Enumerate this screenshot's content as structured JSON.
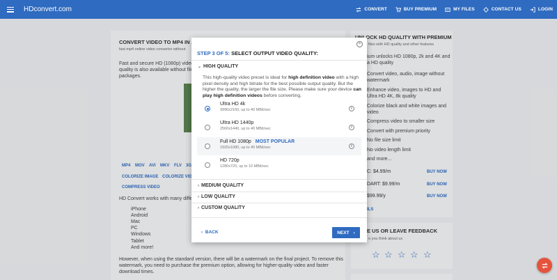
{
  "header": {
    "logo": "HDconvert.com",
    "nav": [
      {
        "label": "CONVERT",
        "icon": "convert-icon"
      },
      {
        "label": "BUY PREMIUM",
        "icon": "cart-icon"
      },
      {
        "label": "MY FILES",
        "icon": "files-icon"
      },
      {
        "label": "CONTACT US",
        "icon": "contact-icon"
      },
      {
        "label": "LOGIN",
        "icon": "login-icon"
      }
    ]
  },
  "main": {
    "title": "CONVERT VIDEO TO MP4 IN A F",
    "subtitle": "fast mp4 online video convertor without",
    "intro_line1": "Fast and secure HD (1080p) video",
    "intro_line2": "quality is also available without file",
    "intro_line3": "packages.",
    "formats": [
      "MP4",
      "MOV",
      "AVI",
      "MKV",
      "FLV",
      "3G"
    ],
    "tools_line1": [
      "COLORIZE IMAGE",
      "COLORIZE VID"
    ],
    "tools_line2": "COMPRESS VIDEO",
    "devices_intro": "HD Convert works with many differ",
    "devices": [
      "iPhone",
      "Android",
      "Mac",
      "PC",
      "Windows",
      "Tablet",
      "And more!"
    ],
    "watermark_line1": "However, when using the standard version, there will be a watermark on the final project. To remove this",
    "watermark_line2": "watermark, you need to purchase the premium option, allowing for higher-quality video and faster",
    "watermark_line3": "download times."
  },
  "side": {
    "title": "UNLOCK HD QUALITY WITH PREMIUM",
    "subtitle": "files with HD quality and other features",
    "features": [
      "ium unlocks HD 1080p, 2k and 4K and",
      "a HD quality",
      "Convert video, audio, image without",
      "watermark",
      "Enhance video, images to HD and",
      "Ultra HD 4K, 8k quality",
      "Colorize black and white images and",
      "video",
      "Compress video to smaller size",
      "Convert with premium priority",
      "No file size limit",
      "No video length limit",
      "and more..."
    ],
    "plans": [
      {
        "price": "C: $4.99/m",
        "action": "BUY NOW"
      },
      {
        "price": "DART: $9.99/m",
        "action": "BUY NOW"
      },
      {
        "price": "$99.99/y",
        "action": "BUY NOW"
      }
    ],
    "details_link": "ILS",
    "feedback_title": "E US OR LEAVE FEEDBACK",
    "feedback_sub": "o you think about us",
    "stars": [
      "☆",
      "☆",
      "☆",
      "☆",
      "☆"
    ]
  },
  "modal": {
    "close": "×",
    "step_prefix": "STEP 3 OF 5:",
    "step_title": "SELECT OUTPUT VIDEO QUALITY:",
    "high_section": "HIGH QUALITY",
    "desc_a": "This high-quality video preset is ideal for ",
    "desc_b": "high definition video",
    "desc_c": " with a high pixel density and high bitrate for the best possible output quality. But the higher the quality, the larger the file size. Please make sure your device ",
    "desc_d": "can play high definition videos",
    "desc_e": " before converting.",
    "options": [
      {
        "name": "Ultra HD 4k",
        "detail": "3996x2160, up to 40 MBit/sec",
        "badge": ""
      },
      {
        "name": "Ultra HD 1440p",
        "detail": "2560x1440, up to 40 MBit/sec",
        "badge": ""
      },
      {
        "name": "Full HD 1080p",
        "detail": "1920x1080, up to 40 MBit/sec",
        "badge": "MOST POPULAR"
      },
      {
        "name": "HD 720p",
        "detail": "1280x720, up to 10 MBit/sec",
        "badge": ""
      }
    ],
    "selected_option": 0,
    "collapsed_sections": [
      "MEDIUM QUALITY",
      "LOW QUALITY",
      "CUSTOM QUALITY"
    ],
    "back_label": "BACK",
    "next_label": "NEXT"
  },
  "colors": {
    "brand": "#2f6bc0",
    "fab": "#e5533d"
  }
}
